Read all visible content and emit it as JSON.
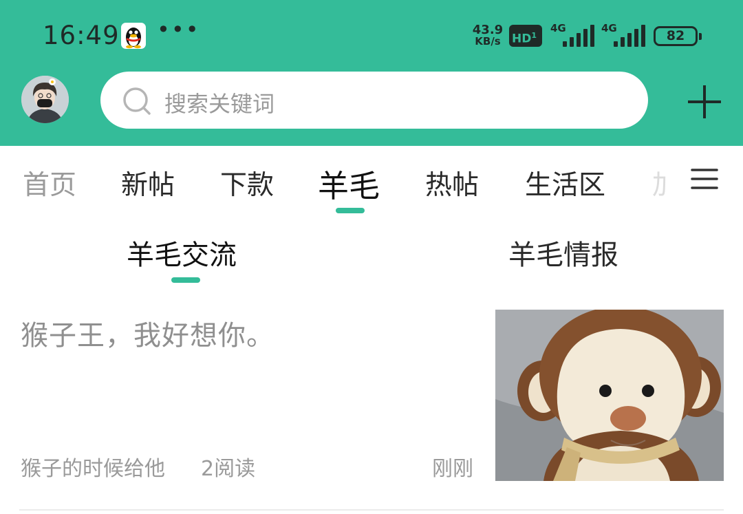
{
  "status_bar": {
    "time": "16:49",
    "net_speed_value": "43.9",
    "net_speed_unit": "KB/s",
    "hd_label": "HD",
    "signal1_label": "4G",
    "signal2_label": "4G",
    "battery": "82",
    "icons": [
      "qq-penguin-icon",
      "more-dots-icon",
      "hd-icon",
      "signal-icon",
      "battery-icon"
    ]
  },
  "header": {
    "search_placeholder": "搜索关键词",
    "icons": [
      "avatar",
      "search-icon",
      "plus-icon"
    ]
  },
  "tabs": [
    {
      "label": "首页",
      "state": "dim"
    },
    {
      "label": "新帖",
      "state": "normal"
    },
    {
      "label": "下款",
      "state": "normal"
    },
    {
      "label": "羊毛",
      "state": "active"
    },
    {
      "label": "热帖",
      "state": "normal"
    },
    {
      "label": "生活区",
      "state": "normal"
    },
    {
      "label": "加",
      "state": "faded"
    }
  ],
  "subtabs": [
    {
      "label": "羊毛交流",
      "active": true
    },
    {
      "label": "羊毛情报",
      "active": false
    }
  ],
  "post": {
    "title": "猴子王，我好想你。",
    "author": "猴子的时候给他",
    "reads": "2阅读",
    "time": "刚刚",
    "thumbnail": "plush-monkey-photo"
  },
  "colors": {
    "accent": "#34bc99",
    "status_text": "#1f2a27",
    "muted_text": "#9a9a9a"
  }
}
